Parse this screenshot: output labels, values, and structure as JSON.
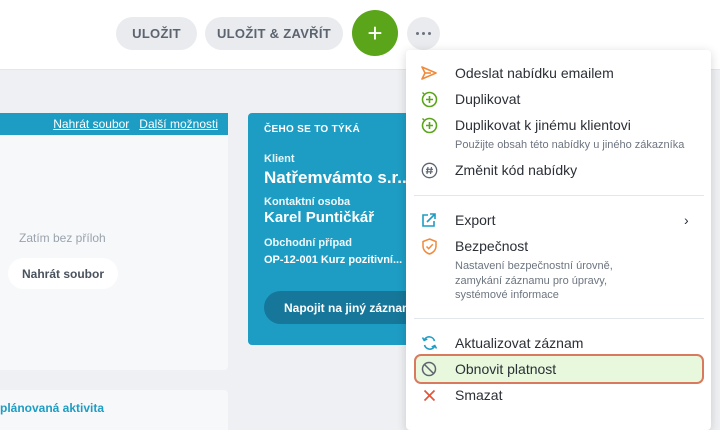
{
  "toolbar": {
    "save_label": "ULOŽIT",
    "save_close_label": "ULOŽIT & ZAVŘÍT",
    "add_label": "+"
  },
  "attachments": {
    "upload_link": "Nahrát soubor",
    "more_link": "Další možnosti",
    "empty_text": "Zatím bez příloh",
    "upload_button": "Nahrát soubor"
  },
  "activity": {
    "label": "plánovaná aktivita"
  },
  "info_card": {
    "title": "ČEHO SE TO TÝKÁ",
    "client_label": "Klient",
    "client_value": "Natřemvámto s.r...",
    "contact_label": "Kontaktní osoba",
    "contact_value": "Karel Puntičkář",
    "case_label": "Obchodní případ",
    "case_value": "OP-12-001 Kurz pozitivní...",
    "link_button": "Napojit na jiný záznam"
  },
  "menu": {
    "items": [
      {
        "icon": "send-icon",
        "label": "Odeslat nabídku emailem"
      },
      {
        "icon": "duplicate-icon",
        "label": "Duplikovat"
      },
      {
        "icon": "duplicate-client-icon",
        "label": "Duplikovat k jinému klientovi",
        "desc": "Použijte obsah této nabídky u jiného zákazníka"
      },
      {
        "icon": "hash-icon",
        "label": "Změnit kód nabídky"
      },
      {
        "icon": "export-icon",
        "label": "Export",
        "chevron": "›"
      },
      {
        "icon": "shield-icon",
        "label": "Bezpečnost",
        "desc": "Nastavení bezpečnostní úrovně, zamykání záznamu pro úpravy, systémové informace"
      },
      {
        "icon": "refresh-icon",
        "label": "Aktualizovat záznam"
      },
      {
        "icon": "ban-icon",
        "label": "Obnovit platnost"
      },
      {
        "icon": "close-icon",
        "label": "Smazat"
      }
    ]
  },
  "colors": {
    "brand_blue": "#1e9dc4",
    "green": "#5aa51a",
    "orange": "#f08a3c",
    "highlight_bg": "#e7f8dd",
    "highlight_border": "#d97a5f"
  }
}
